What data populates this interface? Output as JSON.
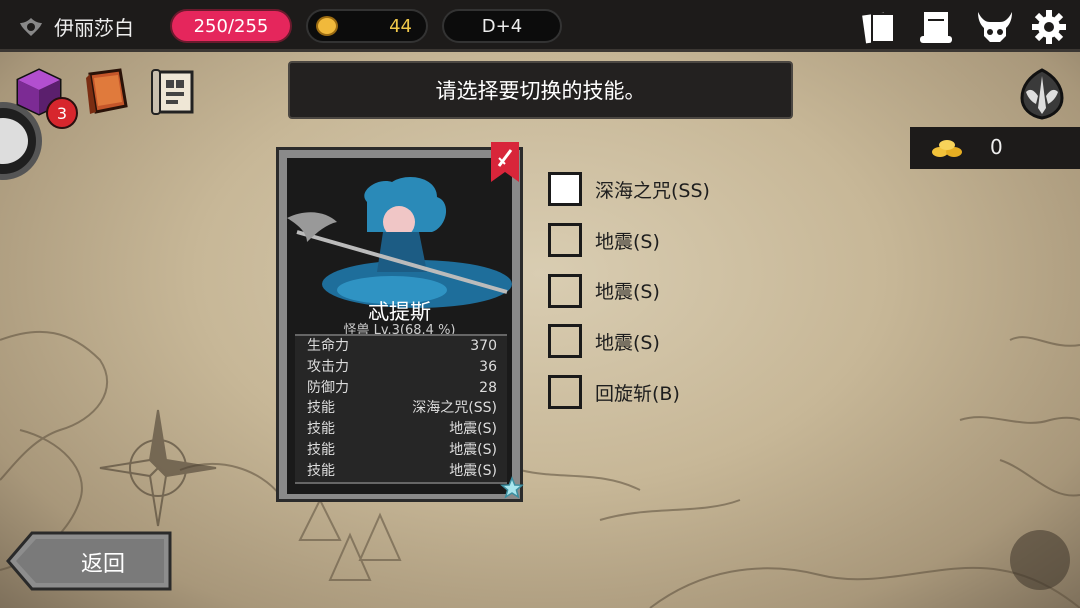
{
  "player": {
    "name": "伊丽莎白"
  },
  "header": {
    "hp": "250/255",
    "gold": "44",
    "day": "D+4"
  },
  "left_icons": {
    "badge_count": "3"
  },
  "instruction": "请选择要切换的技能。",
  "counter": {
    "value": "0"
  },
  "monster": {
    "name": "忒提斯",
    "subtitle": "怪兽 Lv.3(68.4 %)",
    "stats": [
      {
        "label": "生命力",
        "value": "370"
      },
      {
        "label": "攻击力",
        "value": "36"
      },
      {
        "label": "防御力",
        "value": "28"
      },
      {
        "label": "技能",
        "value": "深海之咒(SS)"
      },
      {
        "label": "技能",
        "value": "地震(S)"
      },
      {
        "label": "技能",
        "value": "地震(S)"
      },
      {
        "label": "技能",
        "value": "地震(S)"
      }
    ]
  },
  "skills": [
    {
      "label": "深海之咒(SS)",
      "checked": true
    },
    {
      "label": "地震(S)",
      "checked": false
    },
    {
      "label": "地震(S)",
      "checked": false
    },
    {
      "label": "地震(S)",
      "checked": false
    },
    {
      "label": "回旋斩(B)",
      "checked": false
    }
  ],
  "back_button": "返回",
  "colors": {
    "hp_pill": "#e5265c",
    "gold_text": "#f0c84a",
    "topbar": "#1d1b1a",
    "parchment": "#c7b797"
  },
  "icons": [
    "guild-emblem-icon",
    "gold-coin-icon",
    "cards-icon",
    "scroll-icon",
    "horned-skull-icon",
    "gear-icon",
    "gem-chest-icon",
    "spellbook-icon",
    "map-scroll-icon",
    "winged-crest-icon",
    "gold-pile-icon",
    "bookmark-sword-icon",
    "star-icon",
    "back-arrow-icon"
  ]
}
